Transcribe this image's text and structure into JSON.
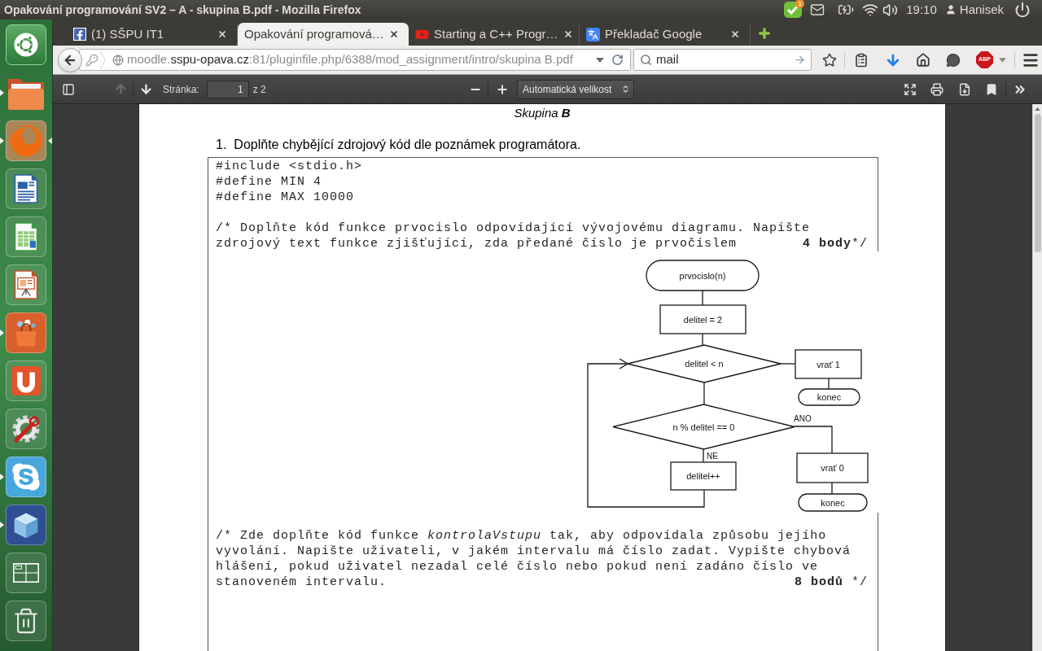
{
  "top_panel": {
    "window_title": "Opakování programování SV2 – A - skupina B.pdf - Mozilla Firefox",
    "indicator_badge": "1",
    "clock": "19:10",
    "user": "Hanisek"
  },
  "launcher": {
    "items": [
      {
        "running": false,
        "focused": false
      },
      {
        "running": true,
        "focused": false
      },
      {
        "running": true,
        "focused": true
      },
      {
        "running": false,
        "focused": false
      },
      {
        "running": false,
        "focused": false
      },
      {
        "running": false,
        "focused": false
      },
      {
        "running": true,
        "focused": false
      },
      {
        "running": false,
        "focused": false
      },
      {
        "running": false,
        "focused": false
      },
      {
        "running": true,
        "focused": false
      },
      {
        "running": true,
        "focused": false
      },
      {
        "running": false,
        "focused": false
      },
      {
        "running": false,
        "focused": false
      }
    ]
  },
  "tabs": [
    {
      "title": "(1) SŠPU IT1",
      "selected": false
    },
    {
      "title": "Opakování programová…",
      "selected": true
    },
    {
      "title": "Starting a C++ Progr…",
      "selected": false
    },
    {
      "title": "Překladač Google",
      "selected": false
    }
  ],
  "navigation": {
    "url": {
      "subdomain": "moodle.",
      "domain": "sspu-opava.cz",
      "path": ":81/pluginfile.php/6388/mod_assignment/intro/skupina B.pdf"
    },
    "search": {
      "value": "mail"
    },
    "adblock_label": "ABP"
  },
  "pdf_toolbar": {
    "previous_page_disabled": true,
    "page_label": "Stránka:",
    "page_value": "1",
    "page_count": "z 2",
    "zoom": "Automatická velikost"
  },
  "document": {
    "heading": "Skupina **B**",
    "task": {
      "number": "1.",
      "text": "Doplňte chybějící zdrojový kód dle poznámek programátora."
    },
    "code_lines": [
      "#include <stdio.h>",
      "#define MIN 4",
      "#define MAX 10000"
    ],
    "comment_1": {
      "lines": [
        [
          {
            "text": "/* Doplňte kód funkce prvocislo odpovídající vývojovému diagramu. Napište",
            "italic": false
          }
        ],
        [
          {
            "text": "zdrojový text funkce zjišťující, zda předané číslo je prvočíslem",
            "italic": false
          }
        ]
      ],
      "points": "4 body",
      "closing": "*/"
    },
    "flowchart": {
      "nodes": [
        {
          "kind": "terminal",
          "label": "prvocislo(n)"
        },
        {
          "kind": "process",
          "label": "delitel = 2"
        },
        {
          "kind": "decision",
          "label": "delitel < n"
        },
        {
          "kind": "process",
          "label": "vrať 1"
        },
        {
          "kind": "terminal",
          "label": "konec"
        },
        {
          "kind": "decision",
          "label": "n % delitel == 0"
        },
        {
          "kind": "process",
          "label": "vrať 0"
        },
        {
          "kind": "process",
          "label": "delitel++"
        },
        {
          "kind": "terminal",
          "label": "konec"
        }
      ],
      "edge_labels": [
        "ANO",
        "NE"
      ]
    },
    "comment_2": {
      "lines": [
        [
          {
            "text": "/* Zde doplňte kód funkce ",
            "italic": false
          },
          {
            "text": "kontrolaVstupu",
            "italic": true
          },
          {
            "text": " tak, aby odpovídala způsobu jejího",
            "italic": false
          }
        ],
        [
          {
            "text": "vyvolání. Napište uživateli, v jakém intervalu má číslo zadat. Vypište chybová",
            "italic": false
          }
        ],
        [
          {
            "text": "hlášení, pokud uživatel nezadal celé číslo nebo pokud není zadáno číslo ve",
            "italic": false
          }
        ],
        [
          {
            "text": "stanoveném intervalu.",
            "italic": false
          }
        ]
      ],
      "points": "8 bodů",
      "closing": " */"
    }
  }
}
